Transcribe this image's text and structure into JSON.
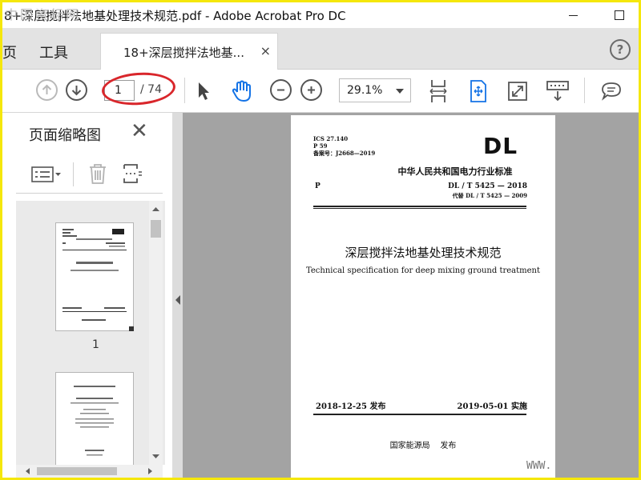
{
  "window": {
    "title": "8+深层搅拌法地基处理技术规范.pdf - Adobe Acrobat Pro DC"
  },
  "tabs": {
    "home": "页",
    "tools": "工具",
    "document": "18+深层搅拌法地基...",
    "document_close": "×",
    "help": "?"
  },
  "toolbar": {
    "page_current": "1",
    "page_total": "/ 74",
    "zoom": "29.1%"
  },
  "sidebar": {
    "title": "页面缩略图",
    "close": "✕",
    "thumb_label": "1"
  },
  "document": {
    "ics": "ICS 27.140",
    "p59": "P 59",
    "record": "备案号：J2668—2019",
    "logo": "DL",
    "category": "P",
    "industry_standard": "中华人民共和国电力行业标准",
    "standard_no": "DL / T  5425 — 2018",
    "replaces": "代替 DL / T  5425 — 2009",
    "title_cn": "深层搅拌法地基处理技术规范",
    "title_en": "Technical specification for deep mixing ground treatment",
    "issue_date": "2018-12-25  发布",
    "impl_date": "2019-05-01  实施",
    "issuer": "国家能源局    发布"
  },
  "watermarks": {
    "top_left": "中国资标网",
    "bottom_right": "WWW."
  },
  "colors": {
    "annotation_red": "#d9262b",
    "hand_tool_blue": "#1473e6",
    "frame_yellow": "#f5e70c"
  }
}
